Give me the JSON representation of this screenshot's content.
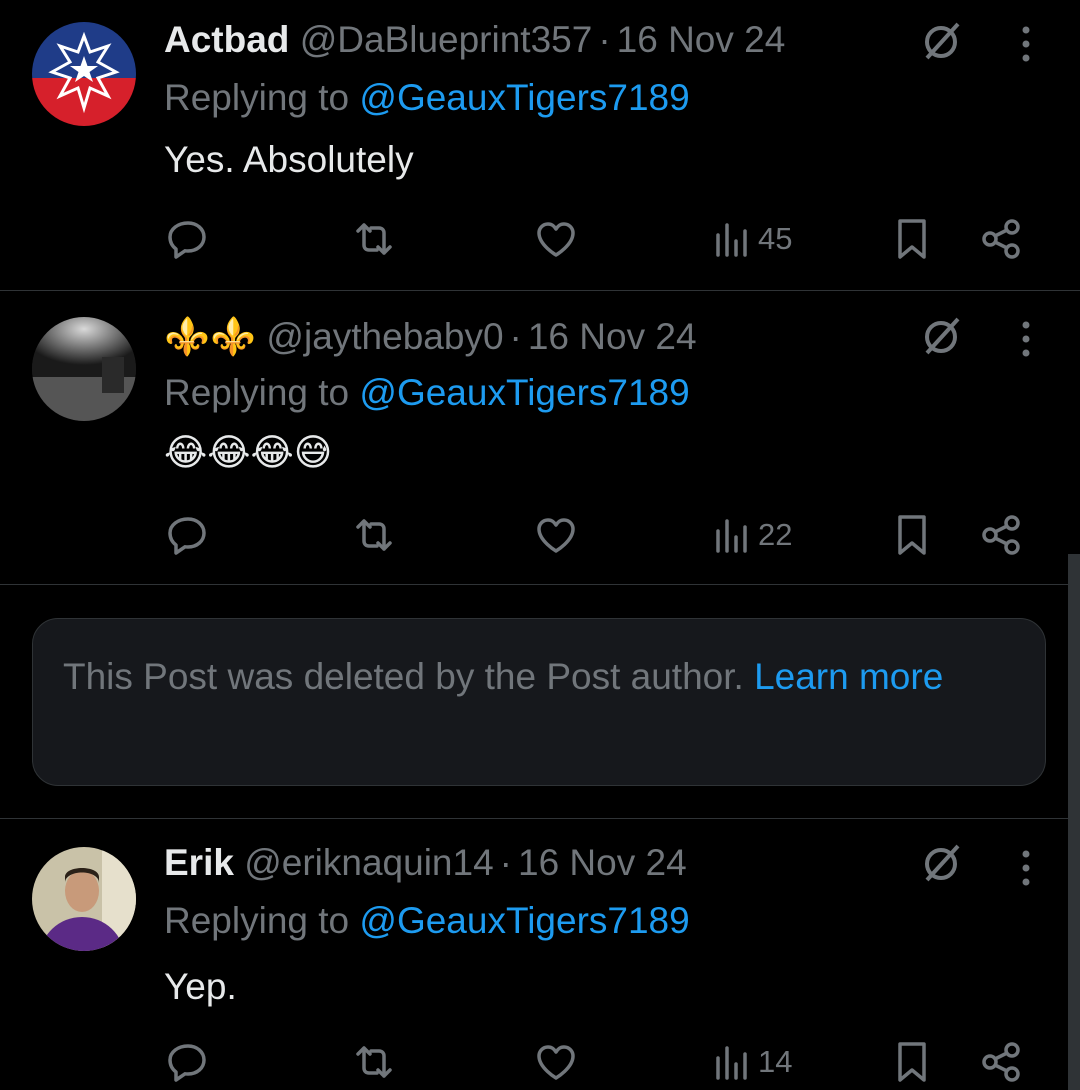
{
  "posts": [
    {
      "name": "Actbad",
      "handle": "@DaBlueprint357",
      "date": "16 Nov 24",
      "replying_prefix": "Replying to",
      "replying_handle": "@GeauxTigers7189",
      "text": "Yes. Absolutely",
      "views": "45"
    },
    {
      "name": "⚜️⚜️",
      "handle": "@jaythebaby0",
      "date": "16 Nov 24",
      "replying_prefix": "Replying to",
      "replying_handle": "@GeauxTigers7189",
      "text": "😂😂😂😅",
      "views": "22"
    },
    {
      "name": "Erik",
      "handle": "@eriknaquin14",
      "date": "16 Nov 24",
      "replying_prefix": "Replying to",
      "replying_handle": "@GeauxTigers7189",
      "text": "Yep.",
      "views": "14"
    }
  ],
  "deleted_notice": {
    "text": "This Post was deleted by the Post author.",
    "link": "Learn more"
  },
  "separator": "·",
  "icons": {
    "reply": "reply-icon",
    "repost": "repost-icon",
    "like": "like-icon",
    "views": "views-icon",
    "bookmark": "bookmark-icon",
    "share": "share-icon",
    "grok": "grok-icon",
    "more": "more-icon"
  },
  "colors": {
    "background": "#000000",
    "text": "#e7e9ea",
    "muted": "#71767b",
    "link": "#1d9bf0",
    "divider": "#2f3336"
  }
}
